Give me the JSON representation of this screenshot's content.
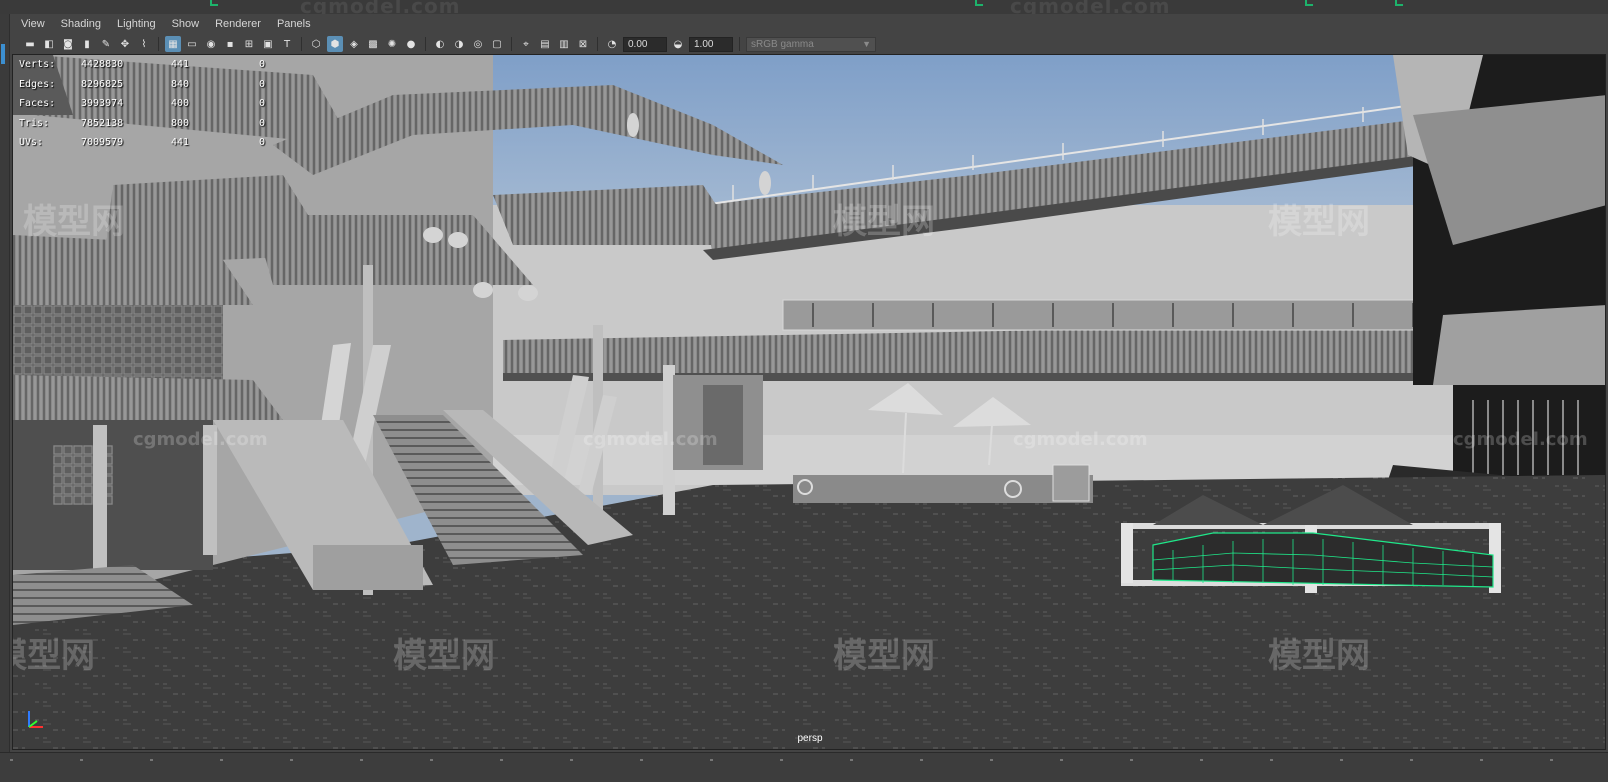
{
  "app": {
    "top_watermark": "cgmodel.com"
  },
  "panel_menu": {
    "items": [
      {
        "label": "View"
      },
      {
        "label": "Shading"
      },
      {
        "label": "Lighting"
      },
      {
        "label": "Show"
      },
      {
        "label": "Renderer"
      },
      {
        "label": "Panels"
      }
    ]
  },
  "toolbar": {
    "exposure_value": "0.00",
    "gamma_value": "1.00",
    "color_space": "sRGB gamma",
    "icons": [
      "select-camera-icon",
      "camera-attributes-icon",
      "bookmark-icon",
      "image-plane-icon",
      "grease-pencil-icon",
      "2d-pan-zoom-icon",
      "grid-icon",
      "film-gate-icon",
      "resolution-gate-icon",
      "gate-mask-icon",
      "field-chart-icon",
      "safe-action-icon",
      "safe-title-icon",
      "wireframe-icon",
      "smooth-shade-icon",
      "default-material-icon",
      "textured-icon",
      "use-all-lights-icon",
      "shadows-icon",
      "screen-space-ao-icon",
      "motion-blur-icon",
      "multisample-aa-icon",
      "depth-of-field-icon",
      "isolate-select-icon",
      "xray-icon",
      "xray-joints-icon",
      "xray-components-icon",
      "exposure-icon",
      "gamma-icon"
    ]
  },
  "hud": {
    "rows": [
      {
        "label": "Verts:",
        "total": "4428830",
        "selected": "441",
        "tris": "0"
      },
      {
        "label": "Edges:",
        "total": "8296825",
        "selected": "840",
        "tris": "0"
      },
      {
        "label": "Faces:",
        "total": "3993974",
        "selected": "400",
        "tris": "0"
      },
      {
        "label": "Tris:",
        "total": "7852138",
        "selected": "800",
        "tris": "0"
      },
      {
        "label": "UVs:",
        "total": "7009579",
        "selected": "441",
        "tris": "0"
      }
    ]
  },
  "viewport": {
    "camera_name": "persp",
    "watermark_latin": "cgmodel.com",
    "watermark_cjk": "模型网",
    "selection_color": "#1fe88a",
    "sky_color_top": "#7f9fc8",
    "sky_color_bottom": "#b9c8d8",
    "ground_color": "#3d3d3d"
  },
  "colors": {
    "panel_bg": "#444444",
    "active_icon": "#5b8fb5",
    "menu_text": "#d6d6d6"
  }
}
